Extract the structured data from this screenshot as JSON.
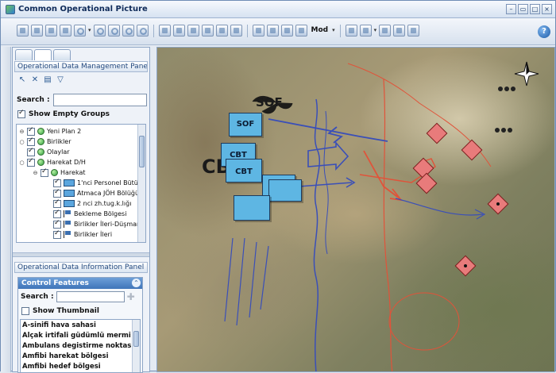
{
  "window": {
    "title": "Common Operational Picture"
  },
  "toolbar": {
    "mode_label": "Mod",
    "help": "?"
  },
  "left_panel": {
    "management_header": "Operational Data Management Panel",
    "search_label": "Search :",
    "show_empty_groups": "Show Empty Groups",
    "tree": [
      {
        "label": "Yeni Plan 2"
      },
      {
        "label": "Birlikler"
      },
      {
        "label": "Olaylar"
      },
      {
        "label": "Harekat D/H"
      },
      {
        "label": "Harekat"
      },
      {
        "label": "1'nci Personel Bütün"
      },
      {
        "label": "Atmaca JÖH Bölüğü"
      },
      {
        "label": "2 nci zh.tug.k.lığı"
      },
      {
        "label": "Bekleme Bölgesi"
      },
      {
        "label": "Birlikler İleri-Düşmanı"
      },
      {
        "label": "Birlikler İleri"
      }
    ],
    "information_header": "Operational Data Information Panel",
    "control_features": {
      "title": "Control Features",
      "search_label": "Search :",
      "show_thumbnail": "Show Thumbnail",
      "items": [
        "A-sinifi hava sahasi",
        "Alçak irtifali güdümlü mermi kı",
        "Ambulans degistirme noktasi",
        "Amfibi harekat bölgesi",
        "Amfibi hedef bölgesi"
      ]
    }
  },
  "map": {
    "labels": {
      "sof": "SOF",
      "cbt_big": "CB",
      "cbt1": "CBT",
      "cbt2": "CBT",
      "sof_box": "SOF"
    },
    "colors": {
      "friendly": "#5eb6e3",
      "hostile": "#e87b7b",
      "arrow_blue": "#3a4fb8",
      "arrow_red": "#e0533a"
    }
  }
}
